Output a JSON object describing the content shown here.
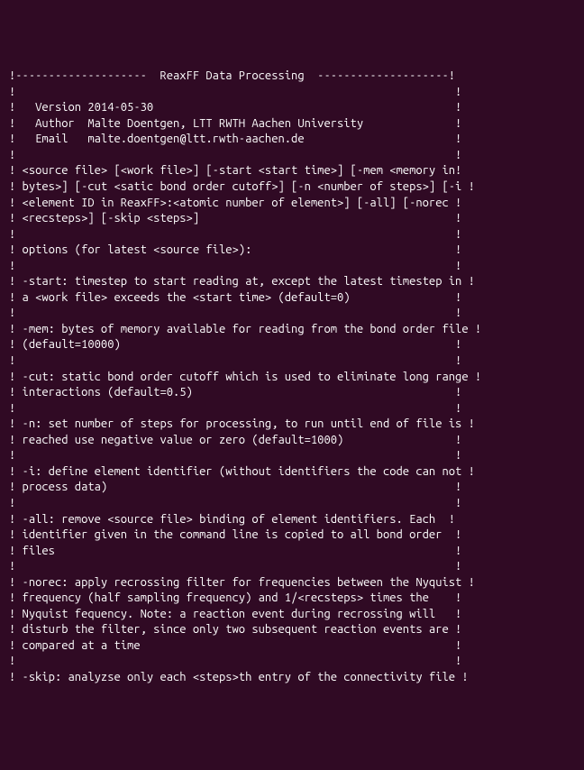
{
  "lines": [
    "!--------------------  ReaxFF Data Processing  --------------------!",
    "!                                                                   !",
    "!   Version 2014-05-30                                              !",
    "!   Author  Malte Doentgen, LTT RWTH Aachen University              !",
    "!   Email   malte.doentgen@ltt.rwth-aachen.de                       !",
    "!                                                                   !",
    "! <source file> [<work file>] [-start <start time>] [-mem <memory in!",
    "! bytes>] [-cut <satic bond order cutoff>] [-n <number of steps>] [-i !",
    "! <element ID in ReaxFF>:<atomic number of element>] [-all] [-norec !",
    "! <recsteps>] [-skip <steps>]                                       !",
    "!                                                                   !",
    "! options (for latest <source file>):                               !",
    "!                                                                   !",
    "! -start: timestep to start reading at, except the latest timestep in !",
    "! a <work file> exceeds the <start time> (default=0)                !",
    "!                                                                   !",
    "! -mem: bytes of memory available for reading from the bond order file !",
    "! (default=10000)                                                   !",
    "!                                                                   !",
    "! -cut: static bond order cutoff which is used to eliminate long range !",
    "! interactions (default=0.5)                                        !",
    "!                                                                   !",
    "! -n: set number of steps for processing, to run until end of file is !",
    "! reached use negative value or zero (default=1000)                 !",
    "!                                                                   !",
    "! -i: define element identifier (without identifiers the code can not !",
    "! process data)                                                     !",
    "!                                                                   !",
    "! -all: remove <source file> binding of element identifiers. Each  !",
    "! identifier given in the command line is copied to all bond order  !",
    "! files                                                             !",
    "!                                                                   !",
    "! -norec: apply recrossing filter for frequencies between the Nyquist !",
    "! frequency (half sampling frequency) and 1/<recsteps> times the    !",
    "! Nyquist fequency. Note: a reaction event during recrossing will   !",
    "! disturb the filter, since only two subsequent reaction events are !",
    "! compared at a time                                                !",
    "!                                                                   !",
    "! -skip: analyzse only each <steps>th entry of the connectivity file !"
  ]
}
